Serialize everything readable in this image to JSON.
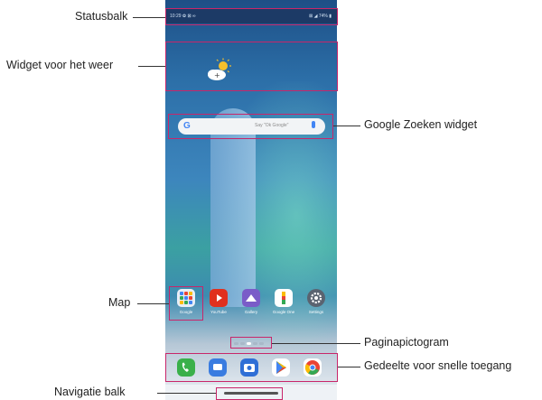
{
  "annotations": {
    "statusbar": "Statusbalk",
    "weather": "Widget voor het weer",
    "search": "Google Zoeken widget",
    "folder": "Map",
    "page": "Paginapictogram",
    "dock": "Gedeelte voor snelle toegang",
    "navbar": "Navigatie balk"
  },
  "phone": {
    "status_time": "10:29 ✿ ⊠ ∞",
    "status_right": "⊠ ◢ 74% ▮",
    "search_placeholder": "Say \"Ok Google\"",
    "search_g": "G",
    "apps": [
      {
        "label": "Google",
        "icon": "folder-icon",
        "color": "#e8eef6"
      },
      {
        "label": "YouTube",
        "icon": "youtube-icon",
        "color": "#e0301e"
      },
      {
        "label": "Gallery",
        "icon": "gallery-icon",
        "color": "#7a5cc8"
      },
      {
        "label": "Google One",
        "icon": "google-one-icon",
        "color": "#ffffff"
      },
      {
        "label": "Settings",
        "icon": "settings-icon",
        "color": "#5a6370"
      }
    ],
    "dock": [
      {
        "icon": "phone-icon",
        "color": "#3ab04a"
      },
      {
        "icon": "messages-icon",
        "color": "#3a7ce0"
      },
      {
        "icon": "camera-icon",
        "color": "#2f6fd6"
      },
      {
        "icon": "play-store-icon",
        "color": "#ffffff"
      },
      {
        "icon": "chrome-icon",
        "color": "#ffffff"
      }
    ]
  },
  "colors": {
    "annotation": "#c8266a"
  }
}
